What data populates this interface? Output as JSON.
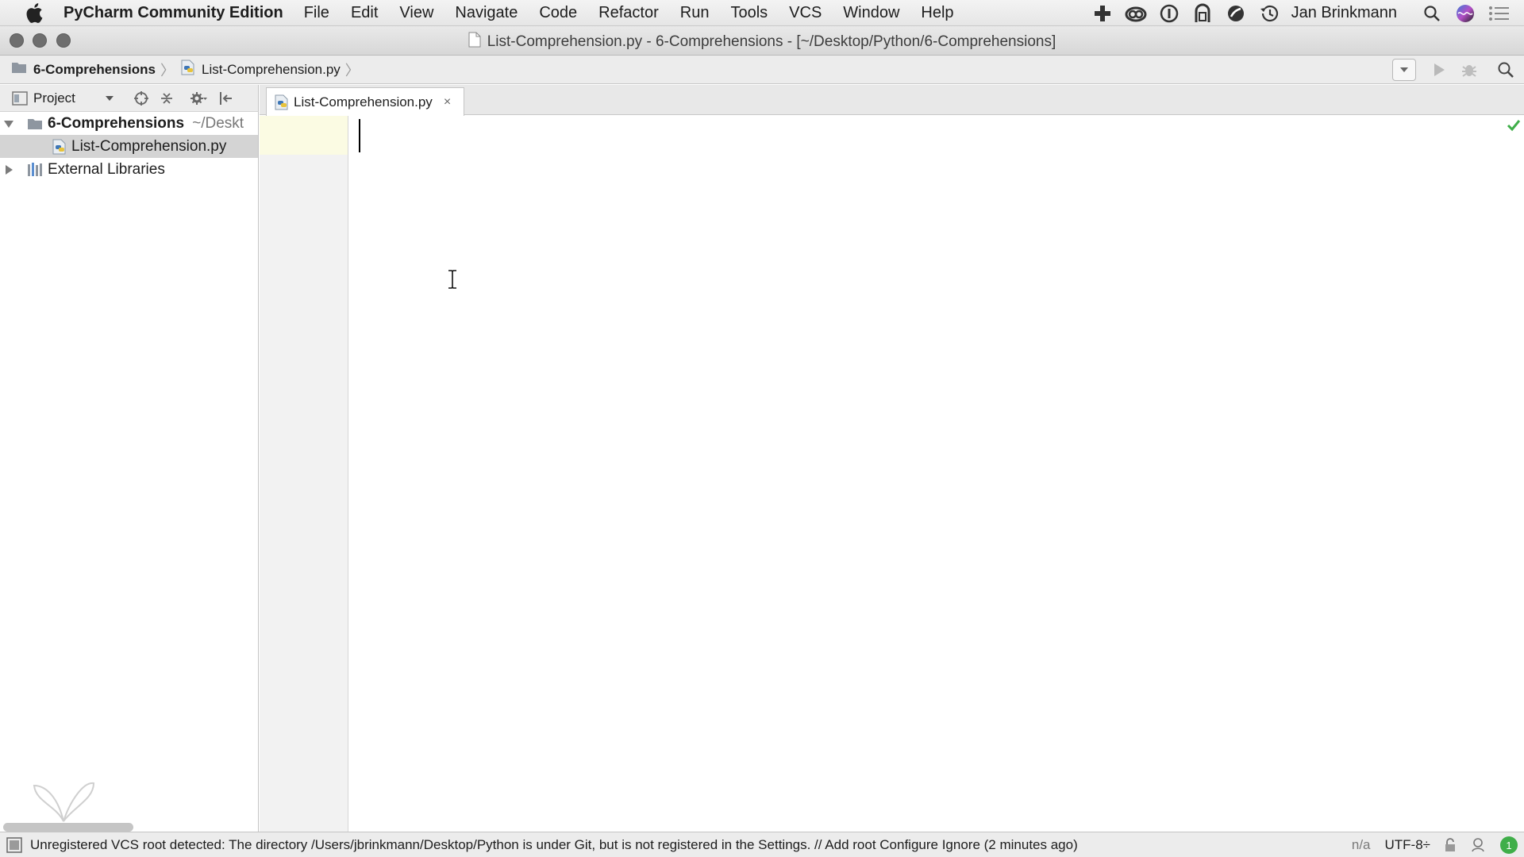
{
  "menubar": {
    "app_name": "PyCharm Community Edition",
    "items": [
      "File",
      "Edit",
      "View",
      "Navigate",
      "Code",
      "Refactor",
      "Run",
      "Tools",
      "VCS",
      "Window",
      "Help"
    ],
    "user_name": "Jan Brinkmann",
    "tray_icons": [
      "plus-icon",
      "creative-cloud-icon",
      "1password-icon",
      "alfred-icon",
      "bartender-icon",
      "time-machine-icon",
      "spotlight-search-icon",
      "siri-icon",
      "notification-list-icon"
    ]
  },
  "window": {
    "title": "List-Comprehension.py - 6-Comprehensions - [~/Desktop/Python/6-Comprehensions]"
  },
  "navbar": {
    "breadcrumbs": [
      "6-Comprehensions",
      "List-Comprehension.py"
    ]
  },
  "project_panel": {
    "view_label": "Project",
    "tree": [
      {
        "label": "6-Comprehensions",
        "hint": "~/Deskt",
        "type": "folder",
        "expanded": true
      },
      {
        "label": "List-Comprehension.py",
        "type": "python-file",
        "selected": true
      },
      {
        "label": "External Libraries",
        "type": "library",
        "expanded": false
      }
    ]
  },
  "editor": {
    "tabs": [
      {
        "label": "List-Comprehension.py",
        "close": "×"
      }
    ]
  },
  "statusbar": {
    "message": "Unregistered VCS root detected: The directory /Users/jbrinkmann/Desktop/Python is under Git, but is not registered in the Settings. // Add root  Configure  Ignore (2 minutes ago)",
    "position": "n/a",
    "encoding": "UTF-8÷",
    "event_count": "1"
  },
  "colors": {
    "accent_green": "#3fae49",
    "current_line": "#fbfbe3"
  }
}
